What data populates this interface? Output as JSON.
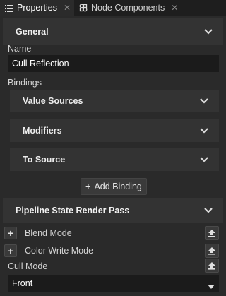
{
  "tabs": [
    {
      "label": "Properties",
      "icon": "list-icon",
      "active": true
    },
    {
      "label": "Node Components",
      "icon": "component-icon",
      "active": false
    }
  ],
  "general": {
    "title": "General",
    "name_label": "Name",
    "name_value": "Cull Reflection",
    "bindings_label": "Bindings",
    "value_sources_label": "Value Sources",
    "modifiers_label": "Modifiers",
    "to_source_label": "To Source",
    "add_binding_label": "Add Binding"
  },
  "pipeline": {
    "title": "Pipeline State Render Pass",
    "blend_mode_label": "Blend Mode",
    "color_write_mode_label": "Color Write Mode",
    "cull_mode_label": "Cull Mode",
    "cull_mode_value": "Front"
  },
  "colors": {
    "background": "#2a2a2a",
    "header": "#333333",
    "field": "#1b1b1b",
    "tabbar": "#1e1e1e"
  }
}
